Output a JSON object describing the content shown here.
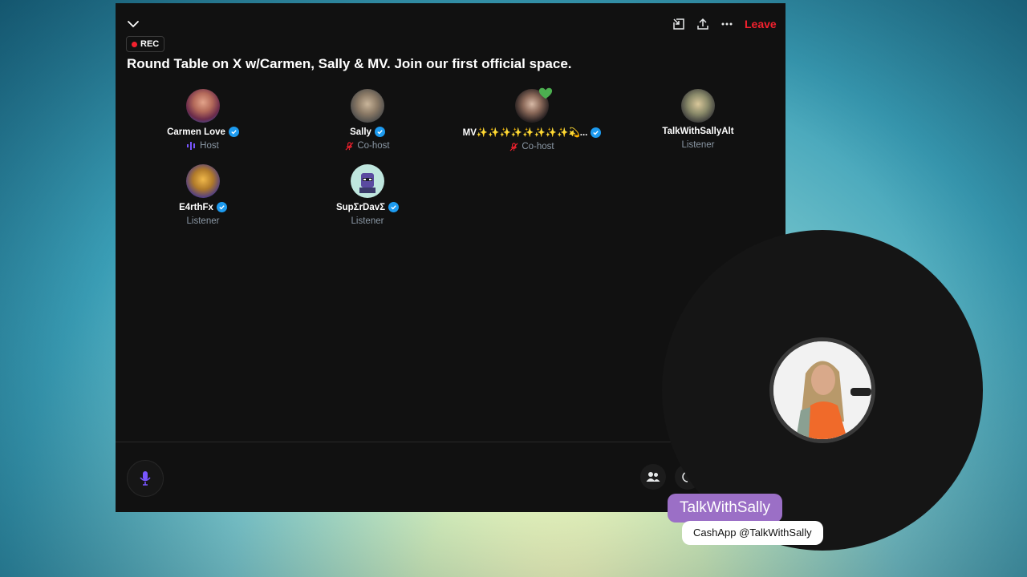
{
  "topbar": {
    "leave_label": "Leave",
    "icons": [
      "chevron-down-icon",
      "share-screen-icon",
      "share-icon",
      "more-icon"
    ]
  },
  "rec_label": "REC",
  "space_title": "Round Table on X w/Carmen, Sally & MV. Join our first official space.",
  "participants": [
    {
      "name": "Carmen Love",
      "role": "Host",
      "verified": true
    },
    {
      "name": "Sally",
      "role": "Co-host",
      "verified": true
    },
    {
      "name": "MV✨✨✨✨✨✨✨✨💫...",
      "role": "Co-host",
      "verified": true
    },
    {
      "name": "TalkWithSallyAlt",
      "role": "Listener",
      "verified": false
    },
    {
      "name": "E4rthFx",
      "role": "Listener",
      "verified": true
    },
    {
      "name": "SupΣrDavΣ",
      "role": "Listener",
      "verified": true
    }
  ],
  "colors": {
    "leave": "#f4212e",
    "verified": "#1d9bf0",
    "host_accent": "#7856ff",
    "cohost_accent": "#f4212e",
    "mic": "#7856ff",
    "name_tag": "#9b6fc6",
    "panel": "#111111"
  },
  "overlay": {
    "name_tag": "TalkWithSally",
    "cashapp": "CashApp @TalkWithSally"
  }
}
